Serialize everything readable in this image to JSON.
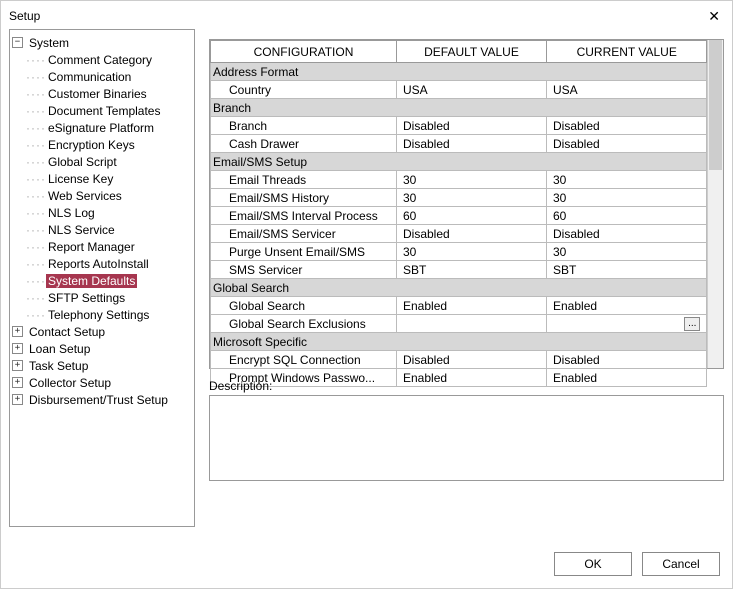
{
  "window": {
    "title": "Setup"
  },
  "tree": {
    "root": {
      "label": "System",
      "expanded": true,
      "children": [
        {
          "label": "Comment Category"
        },
        {
          "label": "Communication"
        },
        {
          "label": "Customer Binaries"
        },
        {
          "label": "Document Templates"
        },
        {
          "label": "eSignature Platform"
        },
        {
          "label": "Encryption Keys"
        },
        {
          "label": "Global Script"
        },
        {
          "label": "License Key"
        },
        {
          "label": "Web Services"
        },
        {
          "label": "NLS Log"
        },
        {
          "label": "NLS Service"
        },
        {
          "label": "Report Manager"
        },
        {
          "label": "Reports AutoInstall"
        },
        {
          "label": "System Defaults",
          "selected": true
        },
        {
          "label": "SFTP Settings"
        },
        {
          "label": "Telephony Settings"
        }
      ]
    },
    "siblings": [
      {
        "label": "Contact Setup"
      },
      {
        "label": "Loan Setup"
      },
      {
        "label": "Task Setup"
      },
      {
        "label": "Collector Setup"
      },
      {
        "label": "Disbursement/Trust Setup"
      }
    ]
  },
  "grid": {
    "headers": {
      "config": "CONFIGURATION",
      "default": "DEFAULT VALUE",
      "current": "CURRENT VALUE"
    },
    "rows": [
      {
        "type": "group",
        "label": "Address Format"
      },
      {
        "type": "item",
        "config": "Country",
        "default": "USA",
        "current": "USA"
      },
      {
        "type": "group",
        "label": "Branch"
      },
      {
        "type": "item",
        "config": "Branch",
        "default": "Disabled",
        "current": "Disabled"
      },
      {
        "type": "item",
        "config": "Cash Drawer",
        "default": "Disabled",
        "current": "Disabled"
      },
      {
        "type": "group",
        "label": "Email/SMS Setup"
      },
      {
        "type": "item",
        "config": "Email Threads",
        "default": "30",
        "current": "30"
      },
      {
        "type": "item",
        "config": "Email/SMS History",
        "default": "30",
        "current": "30"
      },
      {
        "type": "item",
        "config": "Email/SMS Interval Process",
        "default": "60",
        "current": "60"
      },
      {
        "type": "item",
        "config": "Email/SMS Servicer",
        "default": "Disabled",
        "current": "Disabled"
      },
      {
        "type": "item",
        "config": "Purge Unsent Email/SMS",
        "default": "30",
        "current": "30"
      },
      {
        "type": "item",
        "config": "SMS Servicer",
        "default": "SBT",
        "current": "SBT"
      },
      {
        "type": "group",
        "label": "Global Search"
      },
      {
        "type": "item",
        "config": "Global Search",
        "default": "Enabled",
        "current": "Enabled"
      },
      {
        "type": "item",
        "config": "Global Search Exclusions",
        "default": "",
        "current": "",
        "hasButton": true
      },
      {
        "type": "group",
        "label": "Microsoft Specific"
      },
      {
        "type": "item",
        "config": "Encrypt SQL Connection",
        "default": "Disabled",
        "current": "Disabled"
      },
      {
        "type": "item",
        "config": "Prompt Windows Passwo...",
        "default": "Enabled",
        "current": "Enabled"
      }
    ]
  },
  "description": {
    "label": "Description:",
    "value": ""
  },
  "buttons": {
    "ok": "OK",
    "cancel": "Cancel"
  }
}
